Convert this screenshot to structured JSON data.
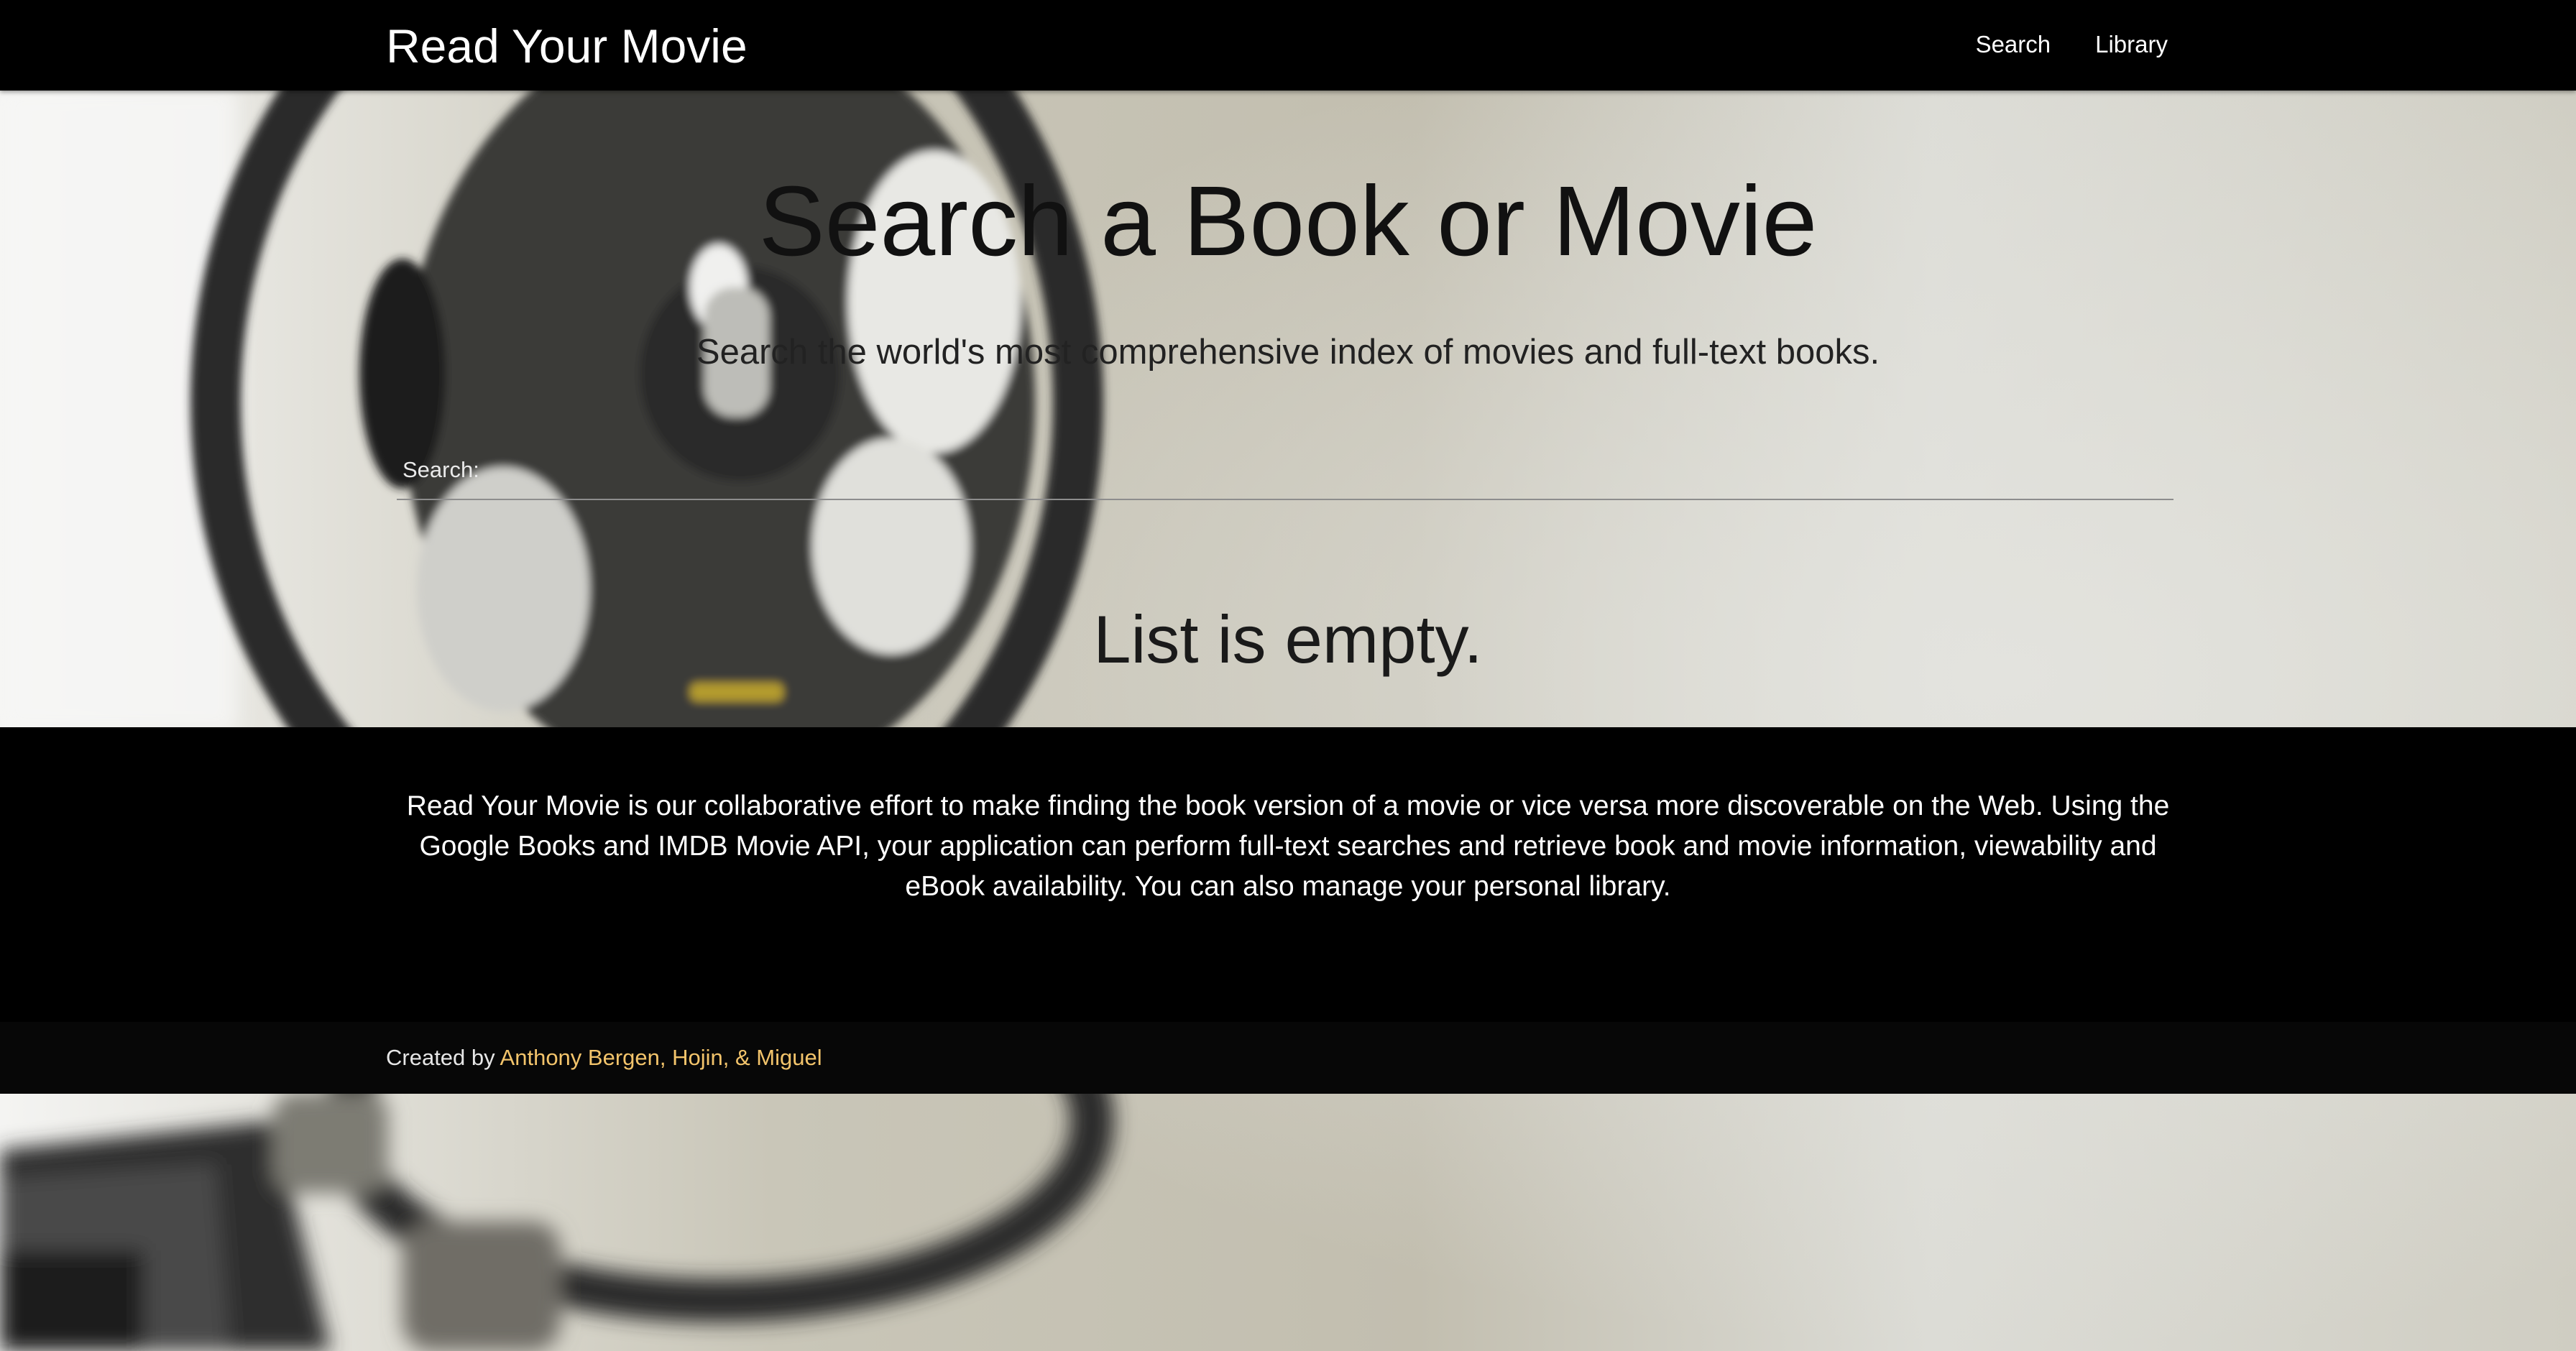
{
  "app": {
    "brand": "Read Your Movie"
  },
  "nav": {
    "items": [
      {
        "label": "Search"
      },
      {
        "label": "Library"
      }
    ]
  },
  "hero": {
    "title": "Search a Book or Movie",
    "subtitle": "Search the world's most comprehensive index of movies and full-text books."
  },
  "search": {
    "label": "Search:",
    "value": ""
  },
  "results": {
    "empty_message": "List is empty."
  },
  "footer": {
    "description": "Read Your Movie is our collaborative effort to make finding the book version of a movie or vice versa more discoverable on the Web. Using the Google Books and IMDB Movie API, your application can perform full-text searches and retrieve book and movie information, viewability and eBook availability. You can also manage your personal library.",
    "credits_prefix": "Created by ",
    "credits_authors": "Anthony Bergen, Hojin, & Miguel"
  },
  "colors": {
    "navbar_bg": "#000000",
    "footer_bg": "#000000",
    "credits_link": "#f3c46b"
  },
  "icons": {
    "background": "film-reel-projector-image"
  }
}
